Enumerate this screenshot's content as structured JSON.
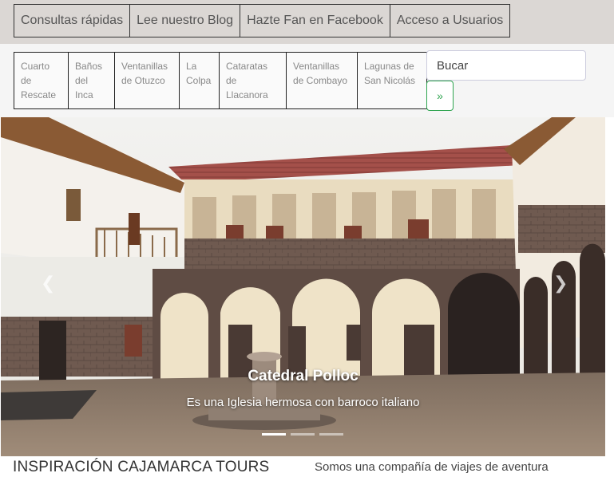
{
  "top_nav": [
    {
      "label": "Consultas rápidas"
    },
    {
      "label": "Lee nuestro Blog"
    },
    {
      "label": "Hazte Fan en Facebook"
    },
    {
      "label": "Acceso a Usuarios"
    }
  ],
  "sub_nav": [
    {
      "line1": "Cuarto",
      "line2": "de",
      "line3": "Rescate"
    },
    {
      "line1": "Baños",
      "line2": "del",
      "line3": "Inca"
    },
    {
      "line1": "Ventanillas",
      "line2": "de Otuzco",
      "line3": ""
    },
    {
      "line1": "La",
      "line2": "Colpa",
      "line3": ""
    },
    {
      "line1": "Cataratas de",
      "line2": "Llacanora",
      "line3": ""
    },
    {
      "line1": "Ventanillas",
      "line2": "de Combayo",
      "line3": ""
    },
    {
      "line1": "Lagunas de",
      "line2": "San Nicolás",
      "line3": ""
    }
  ],
  "search": {
    "placeholder": "Bucar",
    "button_label": "»"
  },
  "carousel": {
    "title": "Catedral Polloc",
    "text": "Es una Iglesia hermosa con barroco italiano",
    "prev_icon": "chevron-left-icon",
    "next_icon": "chevron-right-icon",
    "slide_count": 3,
    "active_slide": 1
  },
  "footer": {
    "brand": "INSPIRACIÓN CAJAMARCA TOURS",
    "tagline": "Somos una compañía de viajes de aventura"
  },
  "colors": {
    "topbar": "#dbd7d4",
    "search_button": "#2ea44f"
  }
}
